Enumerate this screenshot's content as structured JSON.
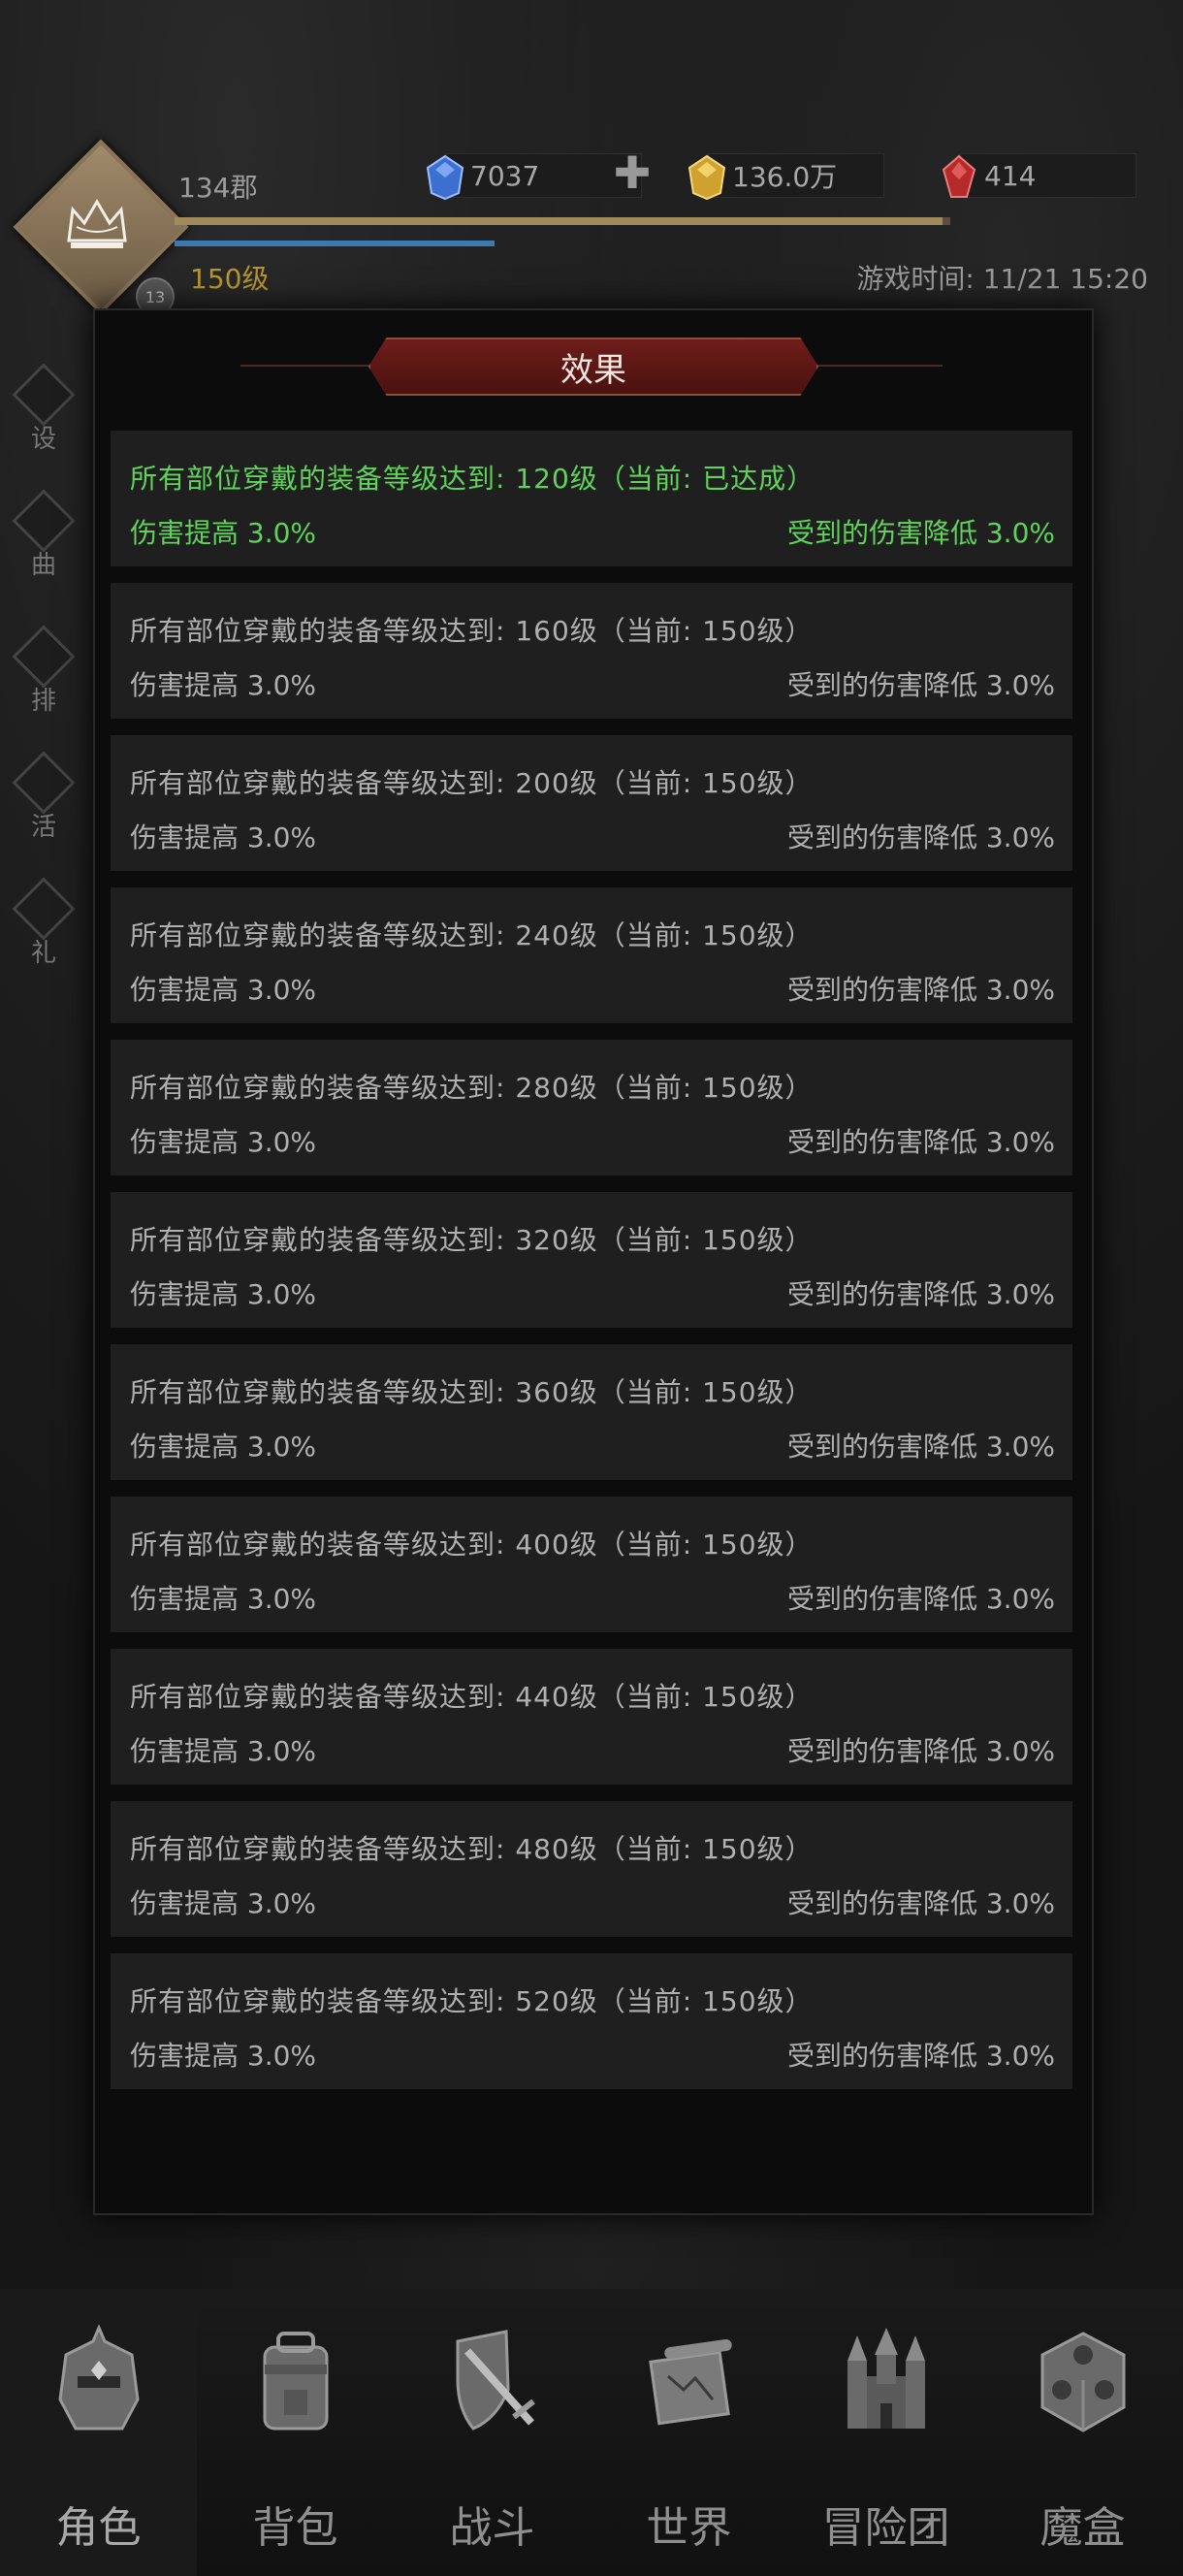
{
  "header": {
    "player_name": "134郡",
    "level": "150级",
    "game_time": "游戏时间: 11/21 15:20",
    "exp_fraction": 0.99,
    "avatar_badge": "13"
  },
  "currencies": [
    {
      "name": "blue-gem",
      "value": "7037",
      "color": "#4a7fd8"
    },
    {
      "name": "gold",
      "value": "136.0万",
      "color": "#d8b23a"
    },
    {
      "name": "red-gem",
      "value": "414",
      "color": "#c83a3a"
    }
  ],
  "side_menu": [
    "设",
    "曲",
    "排",
    "活",
    "礼"
  ],
  "modal": {
    "title": "效果",
    "effects": [
      {
        "condition": "所有部位穿戴的装备等级达到: 120级（当前: 已达成）",
        "damage_up": "伤害提高 3.0%",
        "damage_down": "受到的伤害降低 3.0%",
        "active": true
      },
      {
        "condition": "所有部位穿戴的装备等级达到: 160级（当前: 150级）",
        "damage_up": "伤害提高 3.0%",
        "damage_down": "受到的伤害降低 3.0%",
        "active": false
      },
      {
        "condition": "所有部位穿戴的装备等级达到: 200级（当前: 150级）",
        "damage_up": "伤害提高 3.0%",
        "damage_down": "受到的伤害降低 3.0%",
        "active": false
      },
      {
        "condition": "所有部位穿戴的装备等级达到: 240级（当前: 150级）",
        "damage_up": "伤害提高 3.0%",
        "damage_down": "受到的伤害降低 3.0%",
        "active": false
      },
      {
        "condition": "所有部位穿戴的装备等级达到: 280级（当前: 150级）",
        "damage_up": "伤害提高 3.0%",
        "damage_down": "受到的伤害降低 3.0%",
        "active": false
      },
      {
        "condition": "所有部位穿戴的装备等级达到: 320级（当前: 150级）",
        "damage_up": "伤害提高 3.0%",
        "damage_down": "受到的伤害降低 3.0%",
        "active": false
      },
      {
        "condition": "所有部位穿戴的装备等级达到: 360级（当前: 150级）",
        "damage_up": "伤害提高 3.0%",
        "damage_down": "受到的伤害降低 3.0%",
        "active": false
      },
      {
        "condition": "所有部位穿戴的装备等级达到: 400级（当前: 150级）",
        "damage_up": "伤害提高 3.0%",
        "damage_down": "受到的伤害降低 3.0%",
        "active": false
      },
      {
        "condition": "所有部位穿戴的装备等级达到: 440级（当前: 150级）",
        "damage_up": "伤害提高 3.0%",
        "damage_down": "受到的伤害降低 3.0%",
        "active": false
      },
      {
        "condition": "所有部位穿戴的装备等级达到: 480级（当前: 150级）",
        "damage_up": "伤害提高 3.0%",
        "damage_down": "受到的伤害降低 3.0%",
        "active": false
      },
      {
        "condition": "所有部位穿戴的装备等级达到: 520级（当前: 150级）",
        "damage_up": "伤害提高 3.0%",
        "damage_down": "受到的伤害降低 3.0%",
        "active": false
      }
    ]
  },
  "bottom_nav": [
    {
      "label": "角色",
      "icon": "helmet-icon",
      "active": true
    },
    {
      "label": "背包",
      "icon": "backpack-icon",
      "active": false
    },
    {
      "label": "战斗",
      "icon": "shield-sword-icon",
      "active": false
    },
    {
      "label": "世界",
      "icon": "map-scroll-icon",
      "active": false
    },
    {
      "label": "冒险团",
      "icon": "castle-icon",
      "active": false
    },
    {
      "label": "魔盒",
      "icon": "magic-box-icon",
      "active": false
    }
  ],
  "colors": {
    "active_effect": "#5fd35a",
    "title_banner": "#6e1d1a",
    "level_text": "#b8962e"
  }
}
